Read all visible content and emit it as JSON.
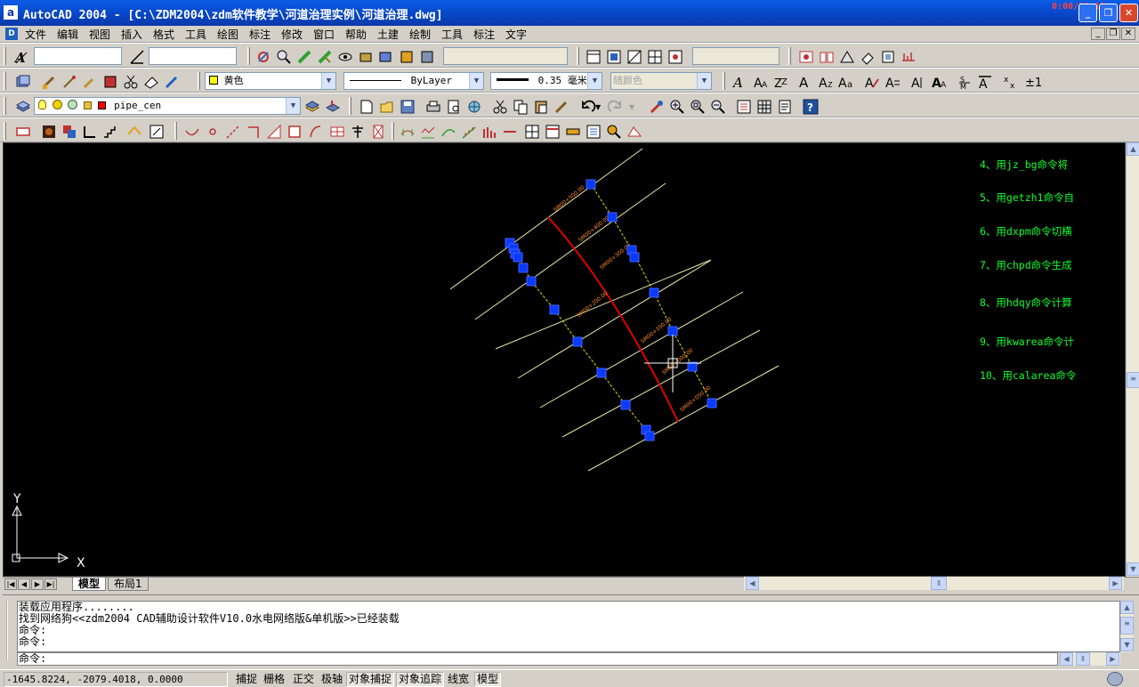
{
  "window": {
    "title": "AutoCAD 2004 - [C:\\ZDM2004\\zdm软件教学\\河道治理实例\\河道治理.dwg]",
    "app_icon": "a",
    "overlay_text": "0:00/10:17"
  },
  "menu": {
    "items": [
      "文件",
      "编辑",
      "视图",
      "插入",
      "格式",
      "工具",
      "绘图",
      "标注",
      "修改",
      "窗口",
      "帮助",
      "土建",
      "绘制",
      "工具",
      "标注",
      "文字"
    ]
  },
  "toolbars": {
    "row2": {
      "dropdown1": "",
      "dropdown2": "",
      "dropdown3": "",
      "dropdown4": ""
    },
    "properties": {
      "color": "黄色",
      "color_swatch": "#ffff00",
      "linetype": "ByLayer",
      "lineweight": "0.35 毫米",
      "plotstyle": "随颜色"
    },
    "layer": {
      "name": "pipe_cen",
      "color_swatch": "#ff0000"
    }
  },
  "drawing": {
    "annotations": [
      "4、用jz_bg命令将",
      "5、用getzh1命令自",
      "6、用dxpm命令切横",
      "7、用chpd命令生成",
      "8、用hdqy命令计算",
      "9、用kwarea命令计",
      "10、用calarea命令"
    ],
    "annotation_color": "#10ff30",
    "ucs": {
      "x": "X",
      "y": "Y"
    },
    "station_labels": [
      "SM00+500.00",
      "SM00+400.00",
      "SM00+300.00",
      "SM00+200.00",
      "SM00+100.00",
      "SM00+000.00",
      "SM00+050.00"
    ]
  },
  "tabs": {
    "model": "模型",
    "layout1": "布局1"
  },
  "command": {
    "lines": [
      "装载应用程序........",
      "找到网络狗<<zdm2004 CAD辅助设计软件V10.0水电网络版&单机版>>已经装载",
      "命令:",
      "命令:"
    ],
    "prompt": "命令:"
  },
  "status": {
    "coordinates": "-1645.8224,  -2079.4018,  0.0000",
    "buttons": [
      {
        "label": "捕捉",
        "on": false
      },
      {
        "label": "栅格",
        "on": false
      },
      {
        "label": "正交",
        "on": false
      },
      {
        "label": "极轴",
        "on": false
      },
      {
        "label": "对象捕捉",
        "on": true
      },
      {
        "label": "对象追踪",
        "on": true
      },
      {
        "label": "线宽",
        "on": false
      },
      {
        "label": "模型",
        "on": true
      }
    ]
  }
}
